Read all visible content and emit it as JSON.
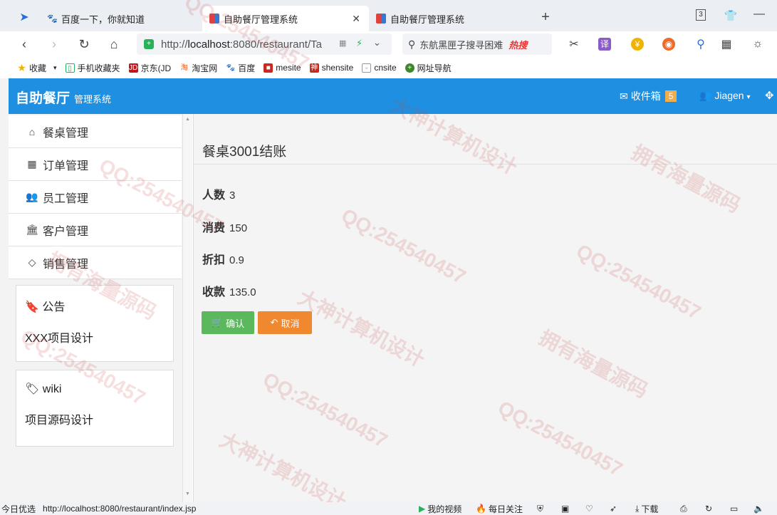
{
  "browser": {
    "tabs": [
      {
        "label": "百度一下，你就知道"
      },
      {
        "label": "自助餐厅管理系统"
      },
      {
        "label": "自助餐厅管理系统"
      }
    ],
    "tab_counter": "3",
    "url_prefix": "http://",
    "url_host": "localhost",
    "url_rest": ":8080/restaurant/Ta",
    "search_text": "东航黑匣子搜寻困难",
    "search_hot": "热搜",
    "bookmarks": [
      {
        "label": "收藏"
      },
      {
        "label": "手机收藏夹"
      },
      {
        "label": "京东(JD"
      },
      {
        "label": "淘宝网"
      },
      {
        "label": "百度"
      },
      {
        "label": "mesite"
      },
      {
        "label": "shensite"
      },
      {
        "label": "cnsite"
      },
      {
        "label": "网址导航"
      }
    ]
  },
  "app": {
    "brand": "自助餐厅",
    "brand_sub": "管理系统",
    "inbox_label": "收件箱",
    "inbox_count": "5",
    "user_name": "Jiagen"
  },
  "sidebar": {
    "menu": [
      {
        "label": "餐桌管理",
        "icon": "home-icon"
      },
      {
        "label": "订单管理",
        "icon": "table-icon"
      },
      {
        "label": "员工管理",
        "icon": "users-icon"
      },
      {
        "label": "客户管理",
        "icon": "bank-icon"
      },
      {
        "label": "销售管理",
        "icon": "diamond-icon"
      }
    ],
    "notice_title": "公告",
    "notice_body": "XXX项目设计",
    "wiki_title": "wiki",
    "wiki_body": "项目源码设计"
  },
  "main": {
    "title": "餐桌3001结账",
    "fields": [
      {
        "label": "人数",
        "value": "3"
      },
      {
        "label": "消费",
        "value": "150"
      },
      {
        "label": "折扣",
        "value": "0.9"
      },
      {
        "label": "收款",
        "value": "135.0"
      }
    ],
    "confirm_label": "确认",
    "cancel_label": "取消"
  },
  "status": {
    "left": "今日优选",
    "url": "http://localhost:8080/restaurant/index.jsp",
    "video": "我的视频",
    "daily": "每日关注",
    "download": "下载"
  },
  "watermarks": [
    "QQ:254540457",
    "大神计算机设计",
    "拥有海量源码"
  ],
  "colors": {
    "header": "#1e8fe1",
    "confirm": "#5cb85c",
    "cancel": "#f0882f",
    "badge": "#f0ad4e"
  }
}
